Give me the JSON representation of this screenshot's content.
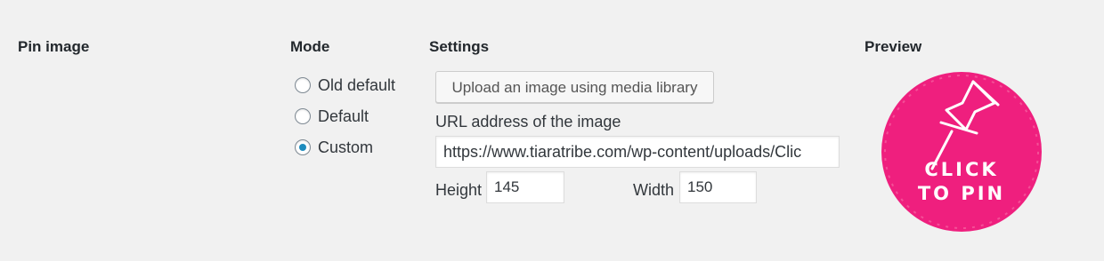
{
  "row": {
    "label": "Pin image"
  },
  "mode": {
    "heading": "Mode",
    "options": [
      {
        "label": "Old default",
        "checked": false
      },
      {
        "label": "Default",
        "checked": false
      },
      {
        "label": "Custom",
        "checked": true
      }
    ]
  },
  "settings": {
    "heading": "Settings",
    "upload_button": "Upload an image using media library",
    "url_label": "URL address of the image",
    "url_value": "https://www.tiaratribe.com/wp-content/uploads/Clic",
    "height_label": "Height",
    "height_value": "145",
    "width_label": "Width",
    "width_value": "150"
  },
  "preview": {
    "heading": "Preview",
    "badge_line1": "CLICK",
    "badge_line2": "TO PIN",
    "badge_color": "#ef1f7e",
    "icon": "pushpin-icon"
  },
  "colors": {
    "background": "#f1f1f1",
    "radio_checked": "#1e8cbe"
  }
}
